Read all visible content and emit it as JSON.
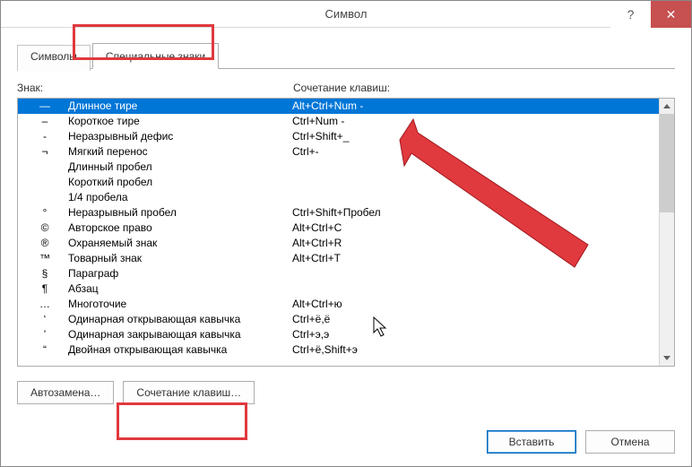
{
  "window": {
    "title": "Символ"
  },
  "tabs": {
    "symbols": "Символы",
    "special": "Специальные знаки"
  },
  "headers": {
    "znak": "Знак:",
    "shortcut": "Сочетание клавиш:"
  },
  "rows": [
    {
      "sym": "—",
      "name": "Длинное тире",
      "shortcut": "Alt+Ctrl+Num -"
    },
    {
      "sym": "–",
      "name": "Короткое тире",
      "shortcut": "Ctrl+Num -"
    },
    {
      "sym": "-",
      "name": "Неразрывный дефис",
      "shortcut": "Ctrl+Shift+_"
    },
    {
      "sym": "¬",
      "name": "Мягкий перенос",
      "shortcut": "Ctrl+-"
    },
    {
      "sym": "",
      "name": "Длинный пробел",
      "shortcut": ""
    },
    {
      "sym": "",
      "name": "Короткий пробел",
      "shortcut": ""
    },
    {
      "sym": "",
      "name": "1/4 пробела",
      "shortcut": ""
    },
    {
      "sym": "°",
      "name": "Неразрывный пробел",
      "shortcut": "Ctrl+Shift+Пробел"
    },
    {
      "sym": "©",
      "name": "Авторское право",
      "shortcut": "Alt+Ctrl+C"
    },
    {
      "sym": "®",
      "name": "Охраняемый знак",
      "shortcut": "Alt+Ctrl+R"
    },
    {
      "sym": "™",
      "name": "Товарный знак",
      "shortcut": "Alt+Ctrl+T"
    },
    {
      "sym": "§",
      "name": "Параграф",
      "shortcut": ""
    },
    {
      "sym": "¶",
      "name": "Абзац",
      "shortcut": ""
    },
    {
      "sym": "…",
      "name": "Многоточие",
      "shortcut": "Alt+Ctrl+ю"
    },
    {
      "sym": "‘",
      "name": "Одинарная открывающая кавычка",
      "shortcut": "Ctrl+ё,ё"
    },
    {
      "sym": "’",
      "name": "Одинарная закрывающая кавычка",
      "shortcut": "Ctrl+э,э"
    },
    {
      "sym": "“",
      "name": "Двойная открывающая кавычка",
      "shortcut": "Ctrl+ё,Shift+э"
    }
  ],
  "buttons": {
    "autoreplace": "Автозамена…",
    "shortcut": "Сочетание клавиш…",
    "insert": "Вставить",
    "cancel": "Отмена"
  }
}
